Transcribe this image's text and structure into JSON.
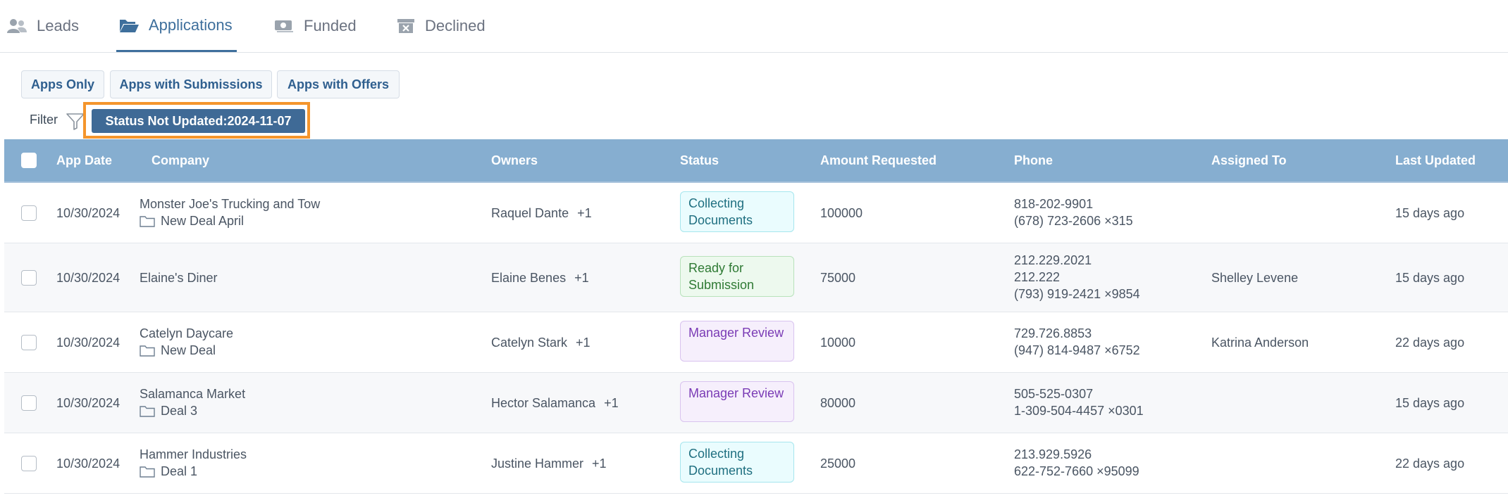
{
  "tabs": [
    {
      "label": "Leads",
      "icon": "users-icon",
      "active": false
    },
    {
      "label": "Applications",
      "icon": "folder-open-icon",
      "active": true
    },
    {
      "label": "Funded",
      "icon": "money-icon",
      "active": false
    },
    {
      "label": "Declined",
      "icon": "archive-x-icon",
      "active": false
    }
  ],
  "filters": {
    "buttons": [
      "Apps Only",
      "Apps with Submissions",
      "Apps with Offers"
    ],
    "label": "Filter",
    "active_filter": "Status Not Updated:2024-11-07"
  },
  "table": {
    "columns": [
      "App Date",
      "Company",
      "Owners",
      "Status",
      "Amount Requested",
      "Phone",
      "Assigned To",
      "Last Updated"
    ],
    "rows": [
      {
        "app_date": "10/30/2024",
        "company": "Monster Joe's Trucking and Tow",
        "deal": "New Deal April",
        "owner": "Raquel Dante",
        "owner_extra": "+1",
        "status": "Collecting Documents",
        "amount": "100000",
        "phones": [
          "818-202-9901",
          "(678) 723-2606 ×315"
        ],
        "assigned_to": "",
        "last_updated": "15 days ago"
      },
      {
        "app_date": "10/30/2024",
        "company": "Elaine's Diner",
        "deal": "",
        "owner": "Elaine Benes",
        "owner_extra": "+1",
        "status": "Ready for Submission",
        "amount": "75000",
        "phones": [
          "212.229.2021",
          "212.222",
          "(793) 919-2421 ×9854"
        ],
        "assigned_to": "Shelley Levene",
        "last_updated": "15 days ago"
      },
      {
        "app_date": "10/30/2024",
        "company": "Catelyn Daycare",
        "deal": "New Deal",
        "owner": "Catelyn Stark",
        "owner_extra": "+1",
        "status": "Manager Review",
        "amount": "10000",
        "phones": [
          "729.726.8853",
          "(947) 814-9487 ×6752"
        ],
        "assigned_to": "Katrina Anderson",
        "last_updated": "22 days ago"
      },
      {
        "app_date": "10/30/2024",
        "company": "Salamanca Market",
        "deal": "Deal 3",
        "owner": "Hector Salamanca",
        "owner_extra": "+1",
        "status": "Manager Review",
        "amount": "80000",
        "phones": [
          "505-525-0307",
          "1-309-504-4457 ×0301"
        ],
        "assigned_to": "",
        "last_updated": "15 days ago"
      },
      {
        "app_date": "10/30/2024",
        "company": "Hammer Industries",
        "deal": "Deal 1",
        "owner": "Justine Hammer",
        "owner_extra": "+1",
        "status": "Collecting Documents",
        "amount": "25000",
        "phones": [
          "213.929.5926",
          "622-752-7660 ×95099"
        ],
        "assigned_to": "",
        "last_updated": "22 days ago"
      }
    ]
  },
  "colors": {
    "accent": "#3e6f9c",
    "header_bg": "#86aed0",
    "highlight_frame": "#f4952c",
    "active_filter_bg": "#3f6a96"
  }
}
